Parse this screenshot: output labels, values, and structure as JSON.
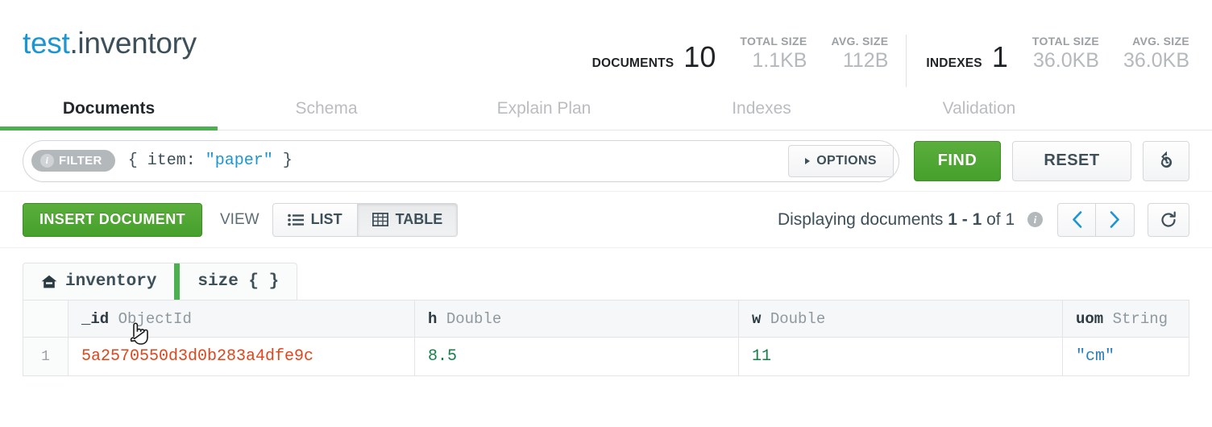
{
  "header": {
    "namespace_db": "test",
    "namespace_sep": ".",
    "namespace_collection": "inventory",
    "stats": [
      {
        "label": "DOCUMENTS",
        "value": "10",
        "sub": [
          {
            "label": "TOTAL SIZE",
            "value": "1.1KB"
          },
          {
            "label": "AVG. SIZE",
            "value": "112B"
          }
        ]
      },
      {
        "label": "INDEXES",
        "value": "1",
        "sub": [
          {
            "label": "TOTAL SIZE",
            "value": "36.0KB"
          },
          {
            "label": "AVG. SIZE",
            "value": "36.0KB"
          }
        ]
      }
    ]
  },
  "tabs": [
    {
      "label": "Documents",
      "active": true
    },
    {
      "label": "Schema",
      "active": false
    },
    {
      "label": "Explain Plan",
      "active": false
    },
    {
      "label": "Indexes",
      "active": false
    },
    {
      "label": "Validation",
      "active": false
    }
  ],
  "querybar": {
    "filter_badge": "FILTER",
    "filter_icon": "info-icon",
    "query_prefix": "{ item: ",
    "query_string": "\"paper\"",
    "query_suffix": " }",
    "query_full": "{ item: \"paper\" }",
    "options_label": "OPTIONS",
    "find_label": "FIND",
    "reset_label": "RESET",
    "history_icon": "history-icon"
  },
  "toolbar": {
    "insert_label": "INSERT DOCUMENT",
    "view_label": "VIEW",
    "view_modes": [
      {
        "label": "LIST",
        "icon": "list-icon",
        "active": false
      },
      {
        "label": "TABLE",
        "icon": "table-grid-icon",
        "active": true
      }
    ],
    "pager_prefix": "Displaying documents",
    "pager_range": "1 - 1",
    "pager_of": "of 1",
    "pager_info_icon": "info-icon",
    "prev_icon": "chevron-left-icon",
    "next_icon": "chevron-right-icon",
    "refresh_icon": "refresh-icon"
  },
  "breadcrumb": {
    "items": [
      {
        "label": "inventory",
        "icon": "home-icon"
      },
      {
        "label": "size { }",
        "icon": null
      }
    ]
  },
  "table": {
    "columns": [
      {
        "name": "_id",
        "type": "ObjectId"
      },
      {
        "name": "h",
        "type": "Double"
      },
      {
        "name": "w",
        "type": "Double"
      },
      {
        "name": "uom",
        "type": "String"
      }
    ],
    "rows": [
      {
        "num": "1",
        "id": "5a2570550d3d0b283a4dfe9c",
        "h": "8.5",
        "w": "11",
        "uom": "\"cm\""
      }
    ]
  },
  "colors": {
    "brand_green": "#4caf50",
    "link_blue": "#1b96d3",
    "objectid_red": "#e0451c",
    "number_green": "#147f4a",
    "string_blue": "#2a7fb8"
  }
}
